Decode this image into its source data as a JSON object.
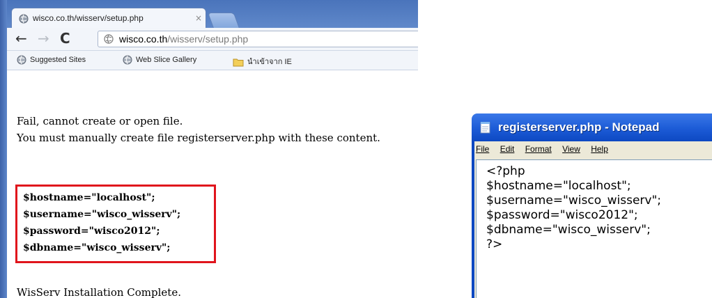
{
  "browser": {
    "tab_title": "wisco.co.th/wisserv/setup.php",
    "tab_close": "×",
    "url_host": "wisco.co.th",
    "url_path": "/wisserv/setup.php",
    "icons": {
      "back": "←",
      "forward": "→",
      "reload": "C"
    },
    "bookmarks": [
      {
        "label": "Suggested Sites",
        "icon": "globe-icon"
      },
      {
        "label": "Web Slice Gallery",
        "icon": "globe-icon"
      },
      {
        "label": "นำเข้าจาก IE",
        "icon": "folder-icon"
      }
    ]
  },
  "page": {
    "line1": "Fail, cannot create or open file.",
    "line2": "You must manually create file registerserver.php with these content.",
    "code": [
      "$hostname=\"localhost\";",
      "$username=\"wisco_wisserv\";",
      "$password=\"wisco2012\";",
      "$dbname=\"wisco_wisserv\";"
    ],
    "complete": "WisServ Installation Complete.",
    "highlight_color": "#e0141c"
  },
  "notepad": {
    "title": "registerserver.php - Notepad",
    "menu": [
      {
        "label": "File"
      },
      {
        "label": "Edit"
      },
      {
        "label": "Format"
      },
      {
        "label": "View"
      },
      {
        "label": "Help"
      }
    ],
    "lines": [
      "<?php",
      "$hostname=\"localhost\";",
      "$username=\"wisco_wisserv\";",
      "$password=\"wisco2012\";",
      "$dbname=\"wisco_wisserv\";",
      "?>"
    ],
    "title_color": "#1c5bd6"
  }
}
